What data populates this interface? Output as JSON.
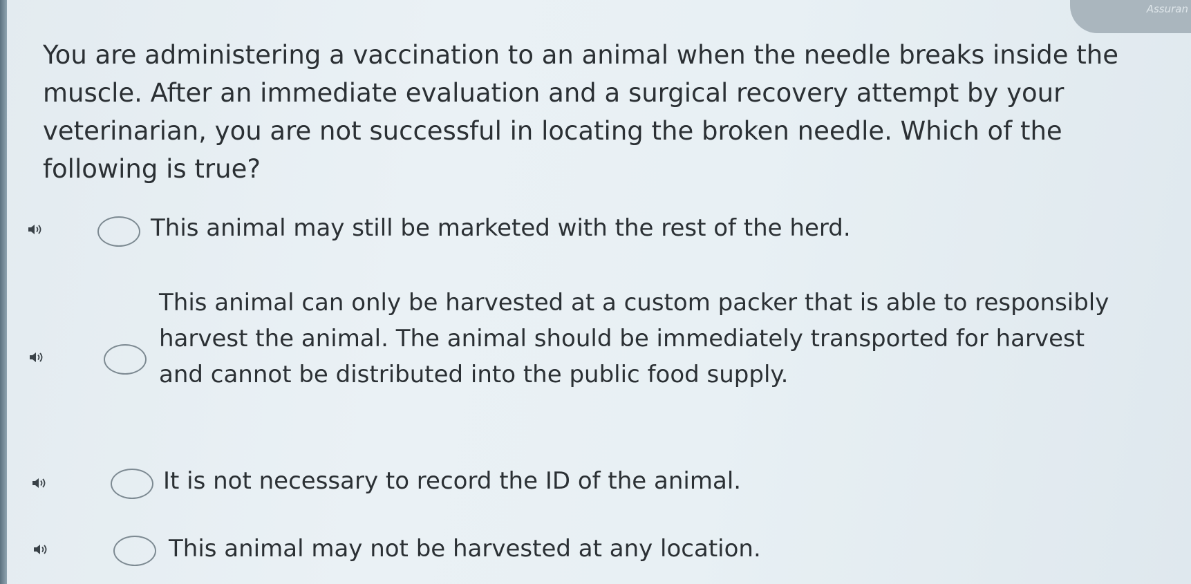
{
  "header": {
    "corner_label": "Assuran"
  },
  "question": {
    "text": "You are administering a vaccination to an animal when the needle breaks inside the muscle. After an immediate evaluation and a surgical recovery attempt by your veterinarian, you are not successful in locating the broken needle. Which of the following is true?"
  },
  "options": [
    {
      "text": "This animal may still be marketed with the rest of the herd.",
      "selected": false
    },
    {
      "text": "This animal can only be harvested at a custom packer that is able to responsibly harvest the animal. The animal should be immediately transported for harvest and cannot be distributed into the public food supply.",
      "selected": false
    },
    {
      "text": "It is not necessary to record the ID of the animal.",
      "selected": false
    },
    {
      "text": "This animal may not be harvested at any location.",
      "selected": false
    }
  ],
  "icons": {
    "audio": "speaker-icon",
    "choice": "radio-circle"
  }
}
